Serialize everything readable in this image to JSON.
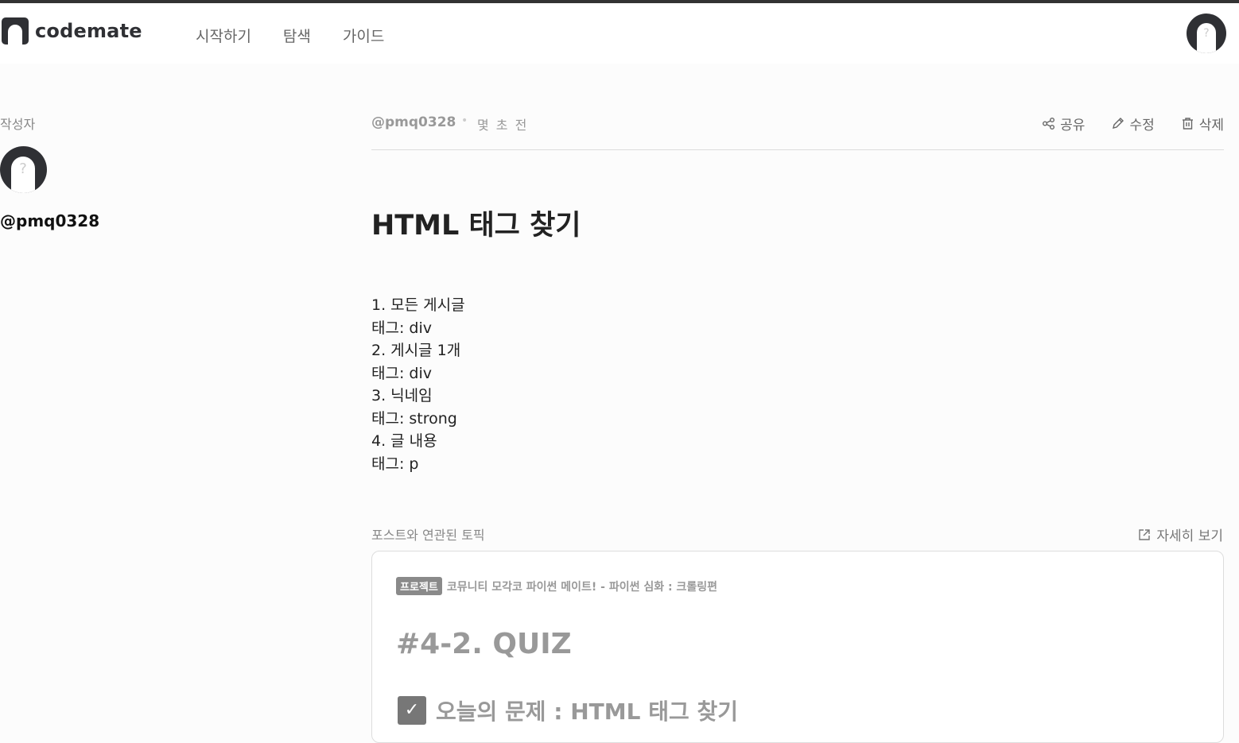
{
  "header": {
    "logo_text": "codemate",
    "nav": [
      "시작하기",
      "탐색",
      "가이드"
    ]
  },
  "author": {
    "label": "작성자",
    "name": "@pmq0328"
  },
  "post": {
    "user": "@pmq0328",
    "time": "몇 초 전",
    "actions": {
      "share": "공유",
      "edit": "수정",
      "delete": "삭제"
    },
    "title": "HTML 태그 찾기",
    "body": [
      "1. 모든 게시글",
      "태그: div",
      "2. 게시글 1개",
      "태그: div",
      "3. 닉네임",
      "태그: strong",
      "4. 글 내용",
      "태그: p"
    ]
  },
  "topics": {
    "label": "포스트와 연관된 토픽",
    "more": "자세히 보기",
    "card": {
      "badge": "프로젝트",
      "course": "코뮤니티 모각코 파이썬 메이트! - 파이썬 심화 : 크롤링편",
      "title": "#4-2. QUIZ",
      "subtitle": "오늘의 문제 : HTML 태그 찾기"
    }
  }
}
